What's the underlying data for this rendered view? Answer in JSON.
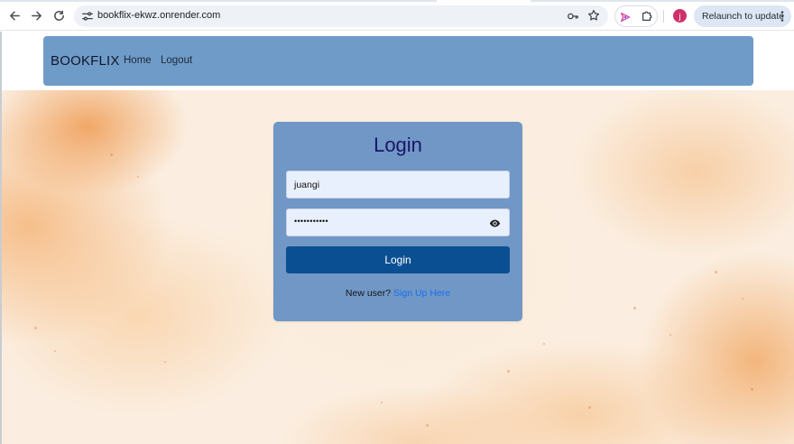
{
  "browser": {
    "url": "bookflix-ekwz.onrender.com",
    "relaunch_label": "Relaunch to update",
    "avatar_initial": "j",
    "icons": [
      "back-arrow-icon",
      "forward-arrow-icon",
      "reload-icon",
      "site-settings-icon",
      "password-key-icon",
      "bookmark-star-icon",
      "gemini-icon",
      "extensions-puzzle-icon",
      "kebab-menu-icon"
    ]
  },
  "navbar": {
    "brand": "BOOKFLIX",
    "links": [
      "Home",
      "Logout"
    ],
    "background_color": "#6f9bc9"
  },
  "login": {
    "title": "Login",
    "username_value": "juangi",
    "password_mask": "•••••••••••",
    "submit_label": "Login",
    "signup_prompt": "New user?",
    "signup_link": "Sign Up Here",
    "card_color": "#7097c6",
    "button_color": "#0b4f93",
    "title_color": "#1a1565",
    "link_color": "#1a6ff0"
  }
}
